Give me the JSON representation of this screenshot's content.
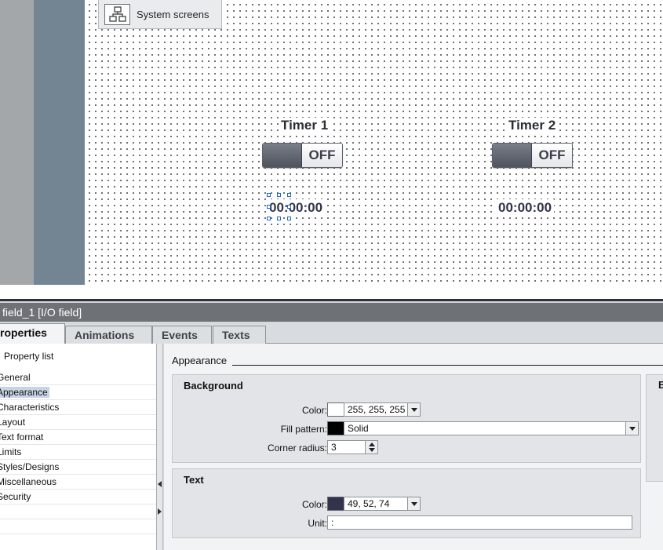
{
  "canvas": {
    "system_screens_label": "System screens",
    "timers": [
      {
        "title": "Timer 1",
        "toggle_state": "OFF",
        "value": "00:00:00"
      },
      {
        "title": "Timer 2",
        "toggle_state": "OFF",
        "value": "00:00:00"
      }
    ]
  },
  "inspector": {
    "title": " field_1 [I/O field]",
    "tabs": [
      {
        "label": "roperties"
      },
      {
        "label": "Animations"
      },
      {
        "label": "Events"
      },
      {
        "label": "Texts"
      }
    ],
    "property_list_label": "Property list",
    "nav_items": [
      {
        "label": "General"
      },
      {
        "label": "Appearance"
      },
      {
        "label": "Characteristics"
      },
      {
        "label": "Layout"
      },
      {
        "label": "Text format"
      },
      {
        "label": "Limits"
      },
      {
        "label": "Styles/Designs"
      },
      {
        "label": "Miscellaneous"
      },
      {
        "label": "Security"
      }
    ],
    "selected_nav": "Appearance",
    "section_heading": "Appearance",
    "background": {
      "group_title": "Background",
      "color_label": "Color:",
      "color_value": "255, 255, 255",
      "color_hex": "#ffffff",
      "fill_pattern_label": "Fill pattern:",
      "fill_pattern_value": "Solid",
      "fill_pattern_swatch_hex": "#000000",
      "corner_radius_label": "Corner radius:",
      "corner_radius_value": "3"
    },
    "text": {
      "group_title": "Text",
      "color_label": "Color:",
      "color_value": "49, 52, 74",
      "color_hex": "#31344a",
      "unit_label": "Unit:",
      "unit_value": ":"
    },
    "right_group_title": "B"
  },
  "colors": {
    "canvas_bg": "#ffffff",
    "sidebar_slate": "#738593",
    "inspector_title_bg": "#6e7277",
    "selection_handle": "#1a6ad4"
  }
}
